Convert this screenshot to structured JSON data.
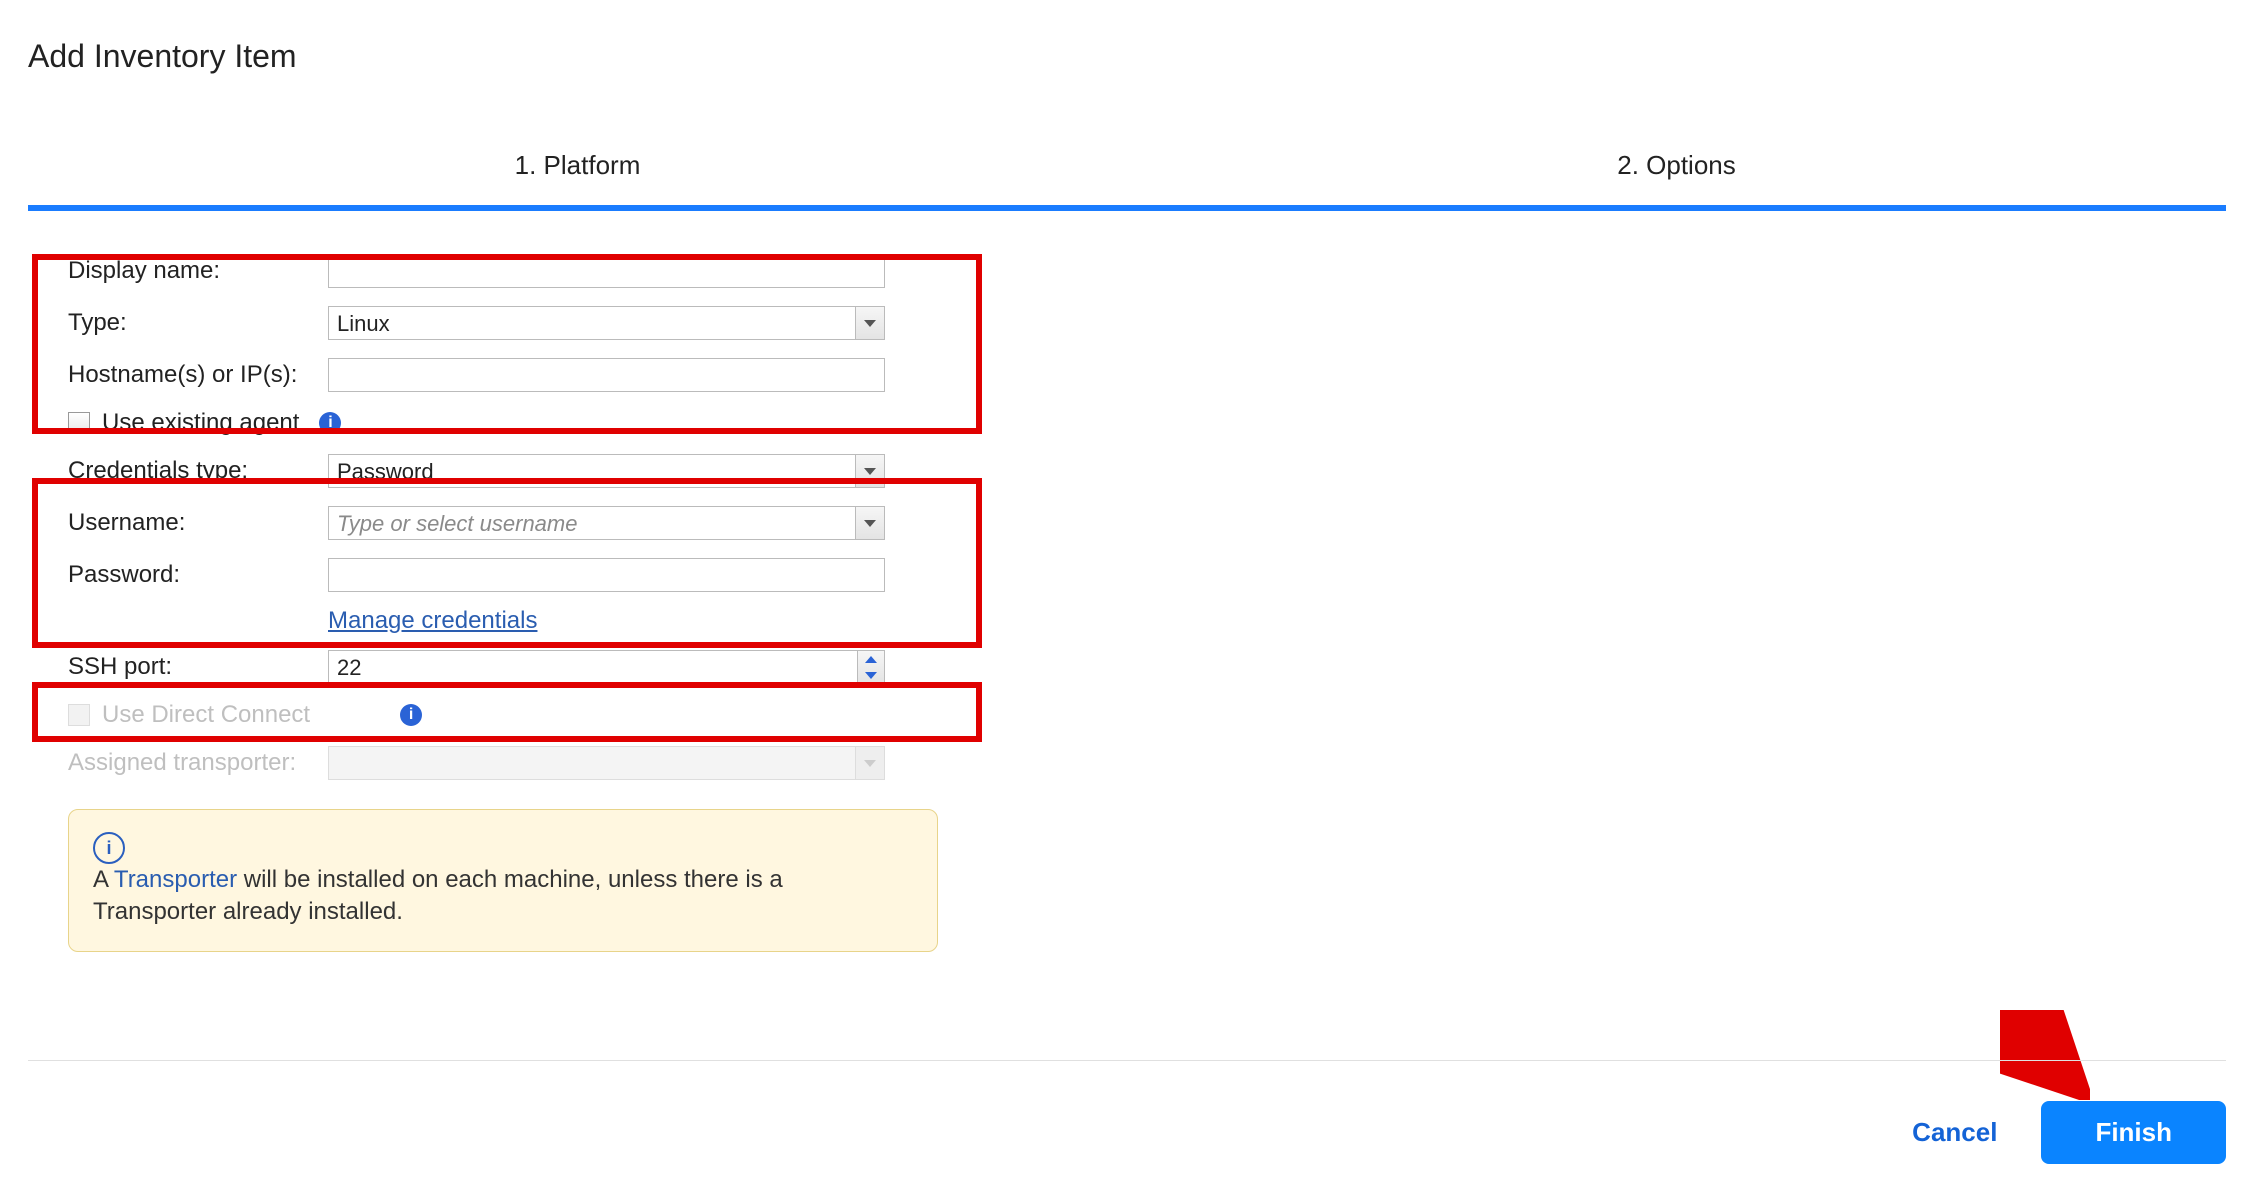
{
  "title": "Add Inventory Item",
  "steps": {
    "step1": "1. Platform",
    "step2": "2. Options"
  },
  "fields": {
    "display_name": {
      "label": "Display name:",
      "value": ""
    },
    "type": {
      "label": "Type:",
      "value": "Linux"
    },
    "hostnames": {
      "label": "Hostname(s) or IP(s):",
      "value": ""
    },
    "use_existing_agent_label": "Use existing agent",
    "credentials_type": {
      "label": "Credentials type:",
      "value": "Password"
    },
    "username": {
      "label": "Username:",
      "placeholder": "Type or select username",
      "value": ""
    },
    "password": {
      "label": "Password:",
      "value": ""
    },
    "manage_credentials_link": "Manage credentials",
    "ssh_port": {
      "label": "SSH port:",
      "value": "22"
    },
    "use_direct_connect_label": "Use Direct Connect",
    "assigned_transporter": {
      "label": "Assigned transporter:",
      "value": ""
    }
  },
  "note": {
    "prefix": "A ",
    "link": "Transporter",
    "suffix": " will be installed on each machine, unless there is a Transporter already installed."
  },
  "buttons": {
    "cancel": "Cancel",
    "finish": "Finish"
  },
  "info_glyph": "i"
}
